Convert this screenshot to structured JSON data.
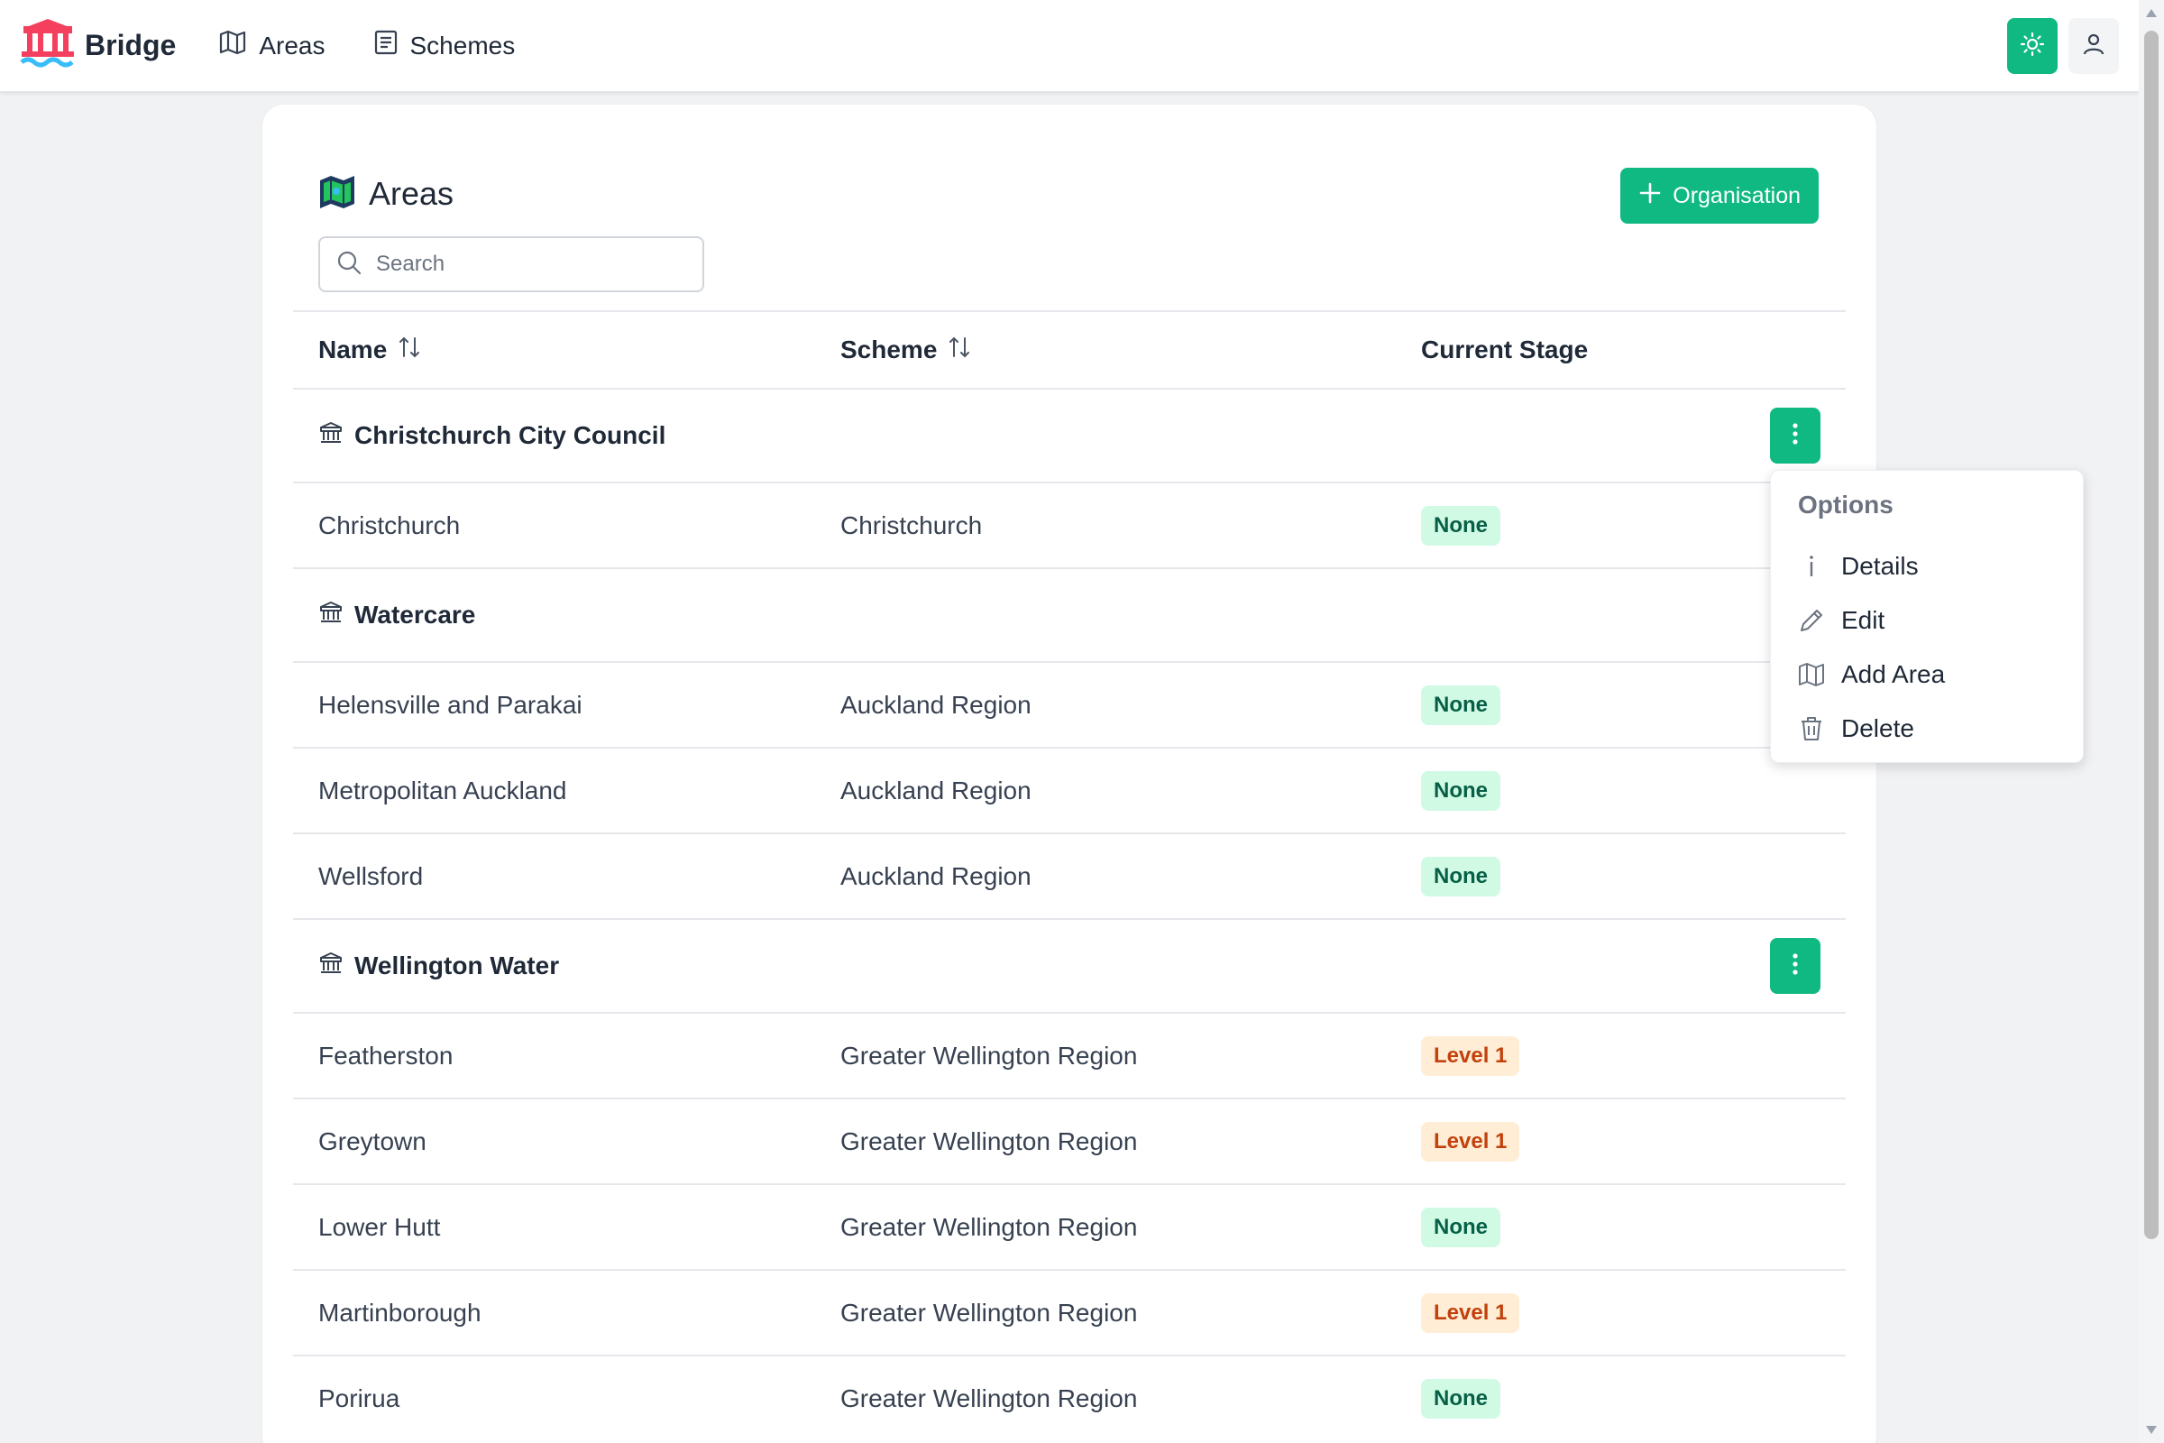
{
  "app": {
    "name": "Bridge"
  },
  "nav": {
    "links": [
      {
        "label": "Areas"
      },
      {
        "label": "Schemes"
      }
    ]
  },
  "page": {
    "title": "Areas",
    "add_button": "Organisation",
    "search_placeholder": "Search"
  },
  "table": {
    "columns": {
      "name": "Name",
      "scheme": "Scheme",
      "stage": "Current Stage"
    },
    "groups": [
      {
        "name": "Christchurch City Council",
        "rows": [
          {
            "name": "Christchurch",
            "scheme": "Christchurch",
            "stage": "None"
          }
        ]
      },
      {
        "name": "Watercare",
        "rows": [
          {
            "name": "Helensville and Parakai",
            "scheme": "Auckland Region",
            "stage": "None"
          },
          {
            "name": "Metropolitan Auckland",
            "scheme": "Auckland Region",
            "stage": "None"
          },
          {
            "name": "Wellsford",
            "scheme": "Auckland Region",
            "stage": "None"
          }
        ]
      },
      {
        "name": "Wellington Water",
        "rows": [
          {
            "name": "Featherston",
            "scheme": "Greater Wellington Region",
            "stage": "Level 1"
          },
          {
            "name": "Greytown",
            "scheme": "Greater Wellington Region",
            "stage": "Level 1"
          },
          {
            "name": "Lower Hutt",
            "scheme": "Greater Wellington Region",
            "stage": "None"
          },
          {
            "name": "Martinborough",
            "scheme": "Greater Wellington Region",
            "stage": "Level 1"
          },
          {
            "name": "Porirua",
            "scheme": "Greater Wellington Region",
            "stage": "None"
          }
        ]
      }
    ]
  },
  "dropdown": {
    "title": "Options",
    "items": [
      {
        "label": "Details",
        "icon": "info-icon"
      },
      {
        "label": "Edit",
        "icon": "pencil-icon"
      },
      {
        "label": "Add Area",
        "icon": "map-icon"
      },
      {
        "label": "Delete",
        "icon": "trash-icon"
      }
    ]
  },
  "colors": {
    "accent": "#10b981",
    "none_badge_bg": "#d1fae5",
    "none_badge_text": "#065f46",
    "level_badge_bg": "#ffedd5",
    "level_badge_text": "#c2410c"
  }
}
